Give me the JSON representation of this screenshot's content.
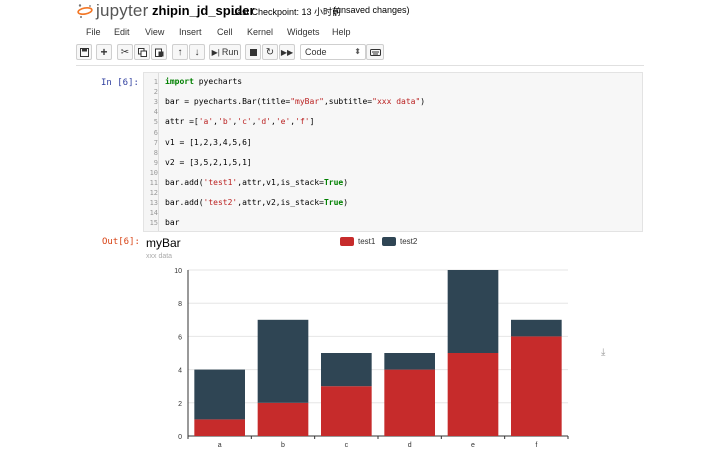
{
  "header": {
    "brand": "jupyter",
    "notebook_name": "zhipin_jd_spider",
    "checkpoint": "Last Checkpoint: 13 小时前",
    "unsaved": "(unsaved changes)"
  },
  "menu": [
    "File",
    "Edit",
    "View",
    "Insert",
    "Cell",
    "Kernel",
    "Widgets",
    "Help"
  ],
  "toolbar": {
    "run_label": "Run",
    "cell_type": "Code"
  },
  "cell": {
    "in_prompt": "In [6]:",
    "out_prompt": "Out[6]:",
    "lines": [
      {
        "n": "1",
        "text": "import pyecharts"
      },
      {
        "n": "2",
        "text": ""
      },
      {
        "n": "3",
        "text": "bar = pyecharts.Bar(title=\"myBar\",subtitle=\"xxx data\")"
      },
      {
        "n": "4",
        "text": ""
      },
      {
        "n": "5",
        "text": "attr =['a','b','c','d','e','f']"
      },
      {
        "n": "6",
        "text": ""
      },
      {
        "n": "7",
        "text": "v1 = [1,2,3,4,5,6]"
      },
      {
        "n": "8",
        "text": ""
      },
      {
        "n": "9",
        "text": "v2 = [3,5,2,1,5,1]"
      },
      {
        "n": "10",
        "text": ""
      },
      {
        "n": "11",
        "text": "bar.add('test1',attr,v1,is_stack=True)"
      },
      {
        "n": "12",
        "text": ""
      },
      {
        "n": "13",
        "text": "bar.add('test2',attr,v2,is_stack=True)"
      },
      {
        "n": "14",
        "text": ""
      },
      {
        "n": "15",
        "text": "bar"
      }
    ]
  },
  "colors": {
    "test1": "#c62b2b",
    "test2": "#2f4554"
  },
  "chart_data": {
    "type": "bar",
    "stacked": true,
    "title": "myBar",
    "subtitle": "xxx data",
    "categories": [
      "a",
      "b",
      "c",
      "d",
      "e",
      "f"
    ],
    "series": [
      {
        "name": "test1",
        "values": [
          1,
          2,
          3,
          4,
          5,
          6
        ]
      },
      {
        "name": "test2",
        "values": [
          3,
          5,
          2,
          1,
          5,
          1
        ]
      }
    ],
    "yticks": [
      "0",
      "2",
      "4",
      "6",
      "8",
      "10"
    ],
    "ylim": [
      0,
      10
    ],
    "grid": true,
    "legend": "top-center"
  }
}
